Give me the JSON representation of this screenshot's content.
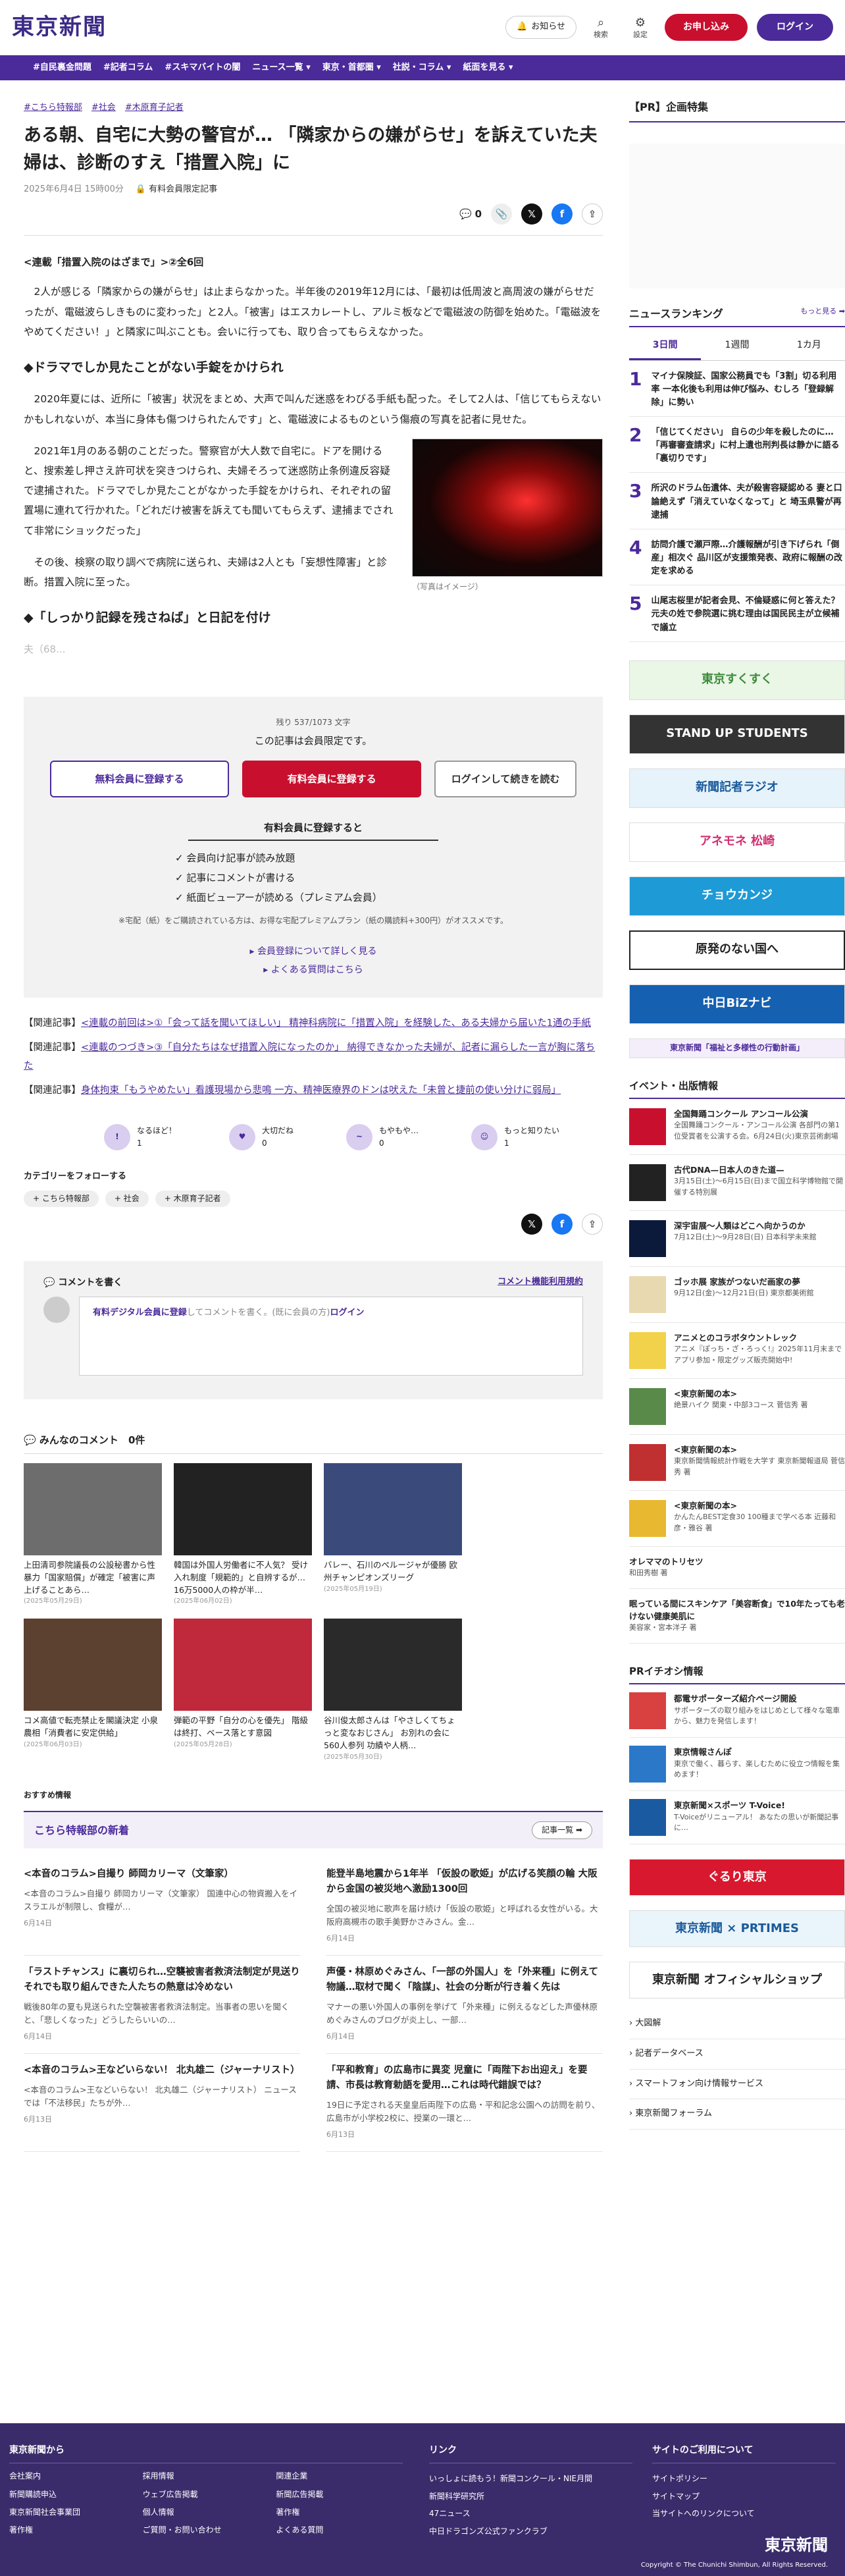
{
  "header": {
    "logo": "東京新聞",
    "notice_label": "お知らせ",
    "search_label": "検索",
    "settings_label": "設定",
    "subscribe_label": "お申し込み",
    "login_label": "ログイン"
  },
  "nav": [
    "#自民裏金問題",
    "#記者コラム",
    "#スキマバイトの闇",
    "ニュース一覧 ▾",
    "東京・首都圏 ▾",
    "社説・コラム ▾",
    "紙面を見る ▾"
  ],
  "article": {
    "tags": [
      "#こちら特報部",
      "#社会",
      "#木原育子記者"
    ],
    "title": "ある朝、自宅に大勢の警官が… 「隣家からの嫌がらせ」を訴えていた夫婦は、診断のすえ「措置入院」に",
    "date": "2025年6月4日 15時00分",
    "paid_label": "有料会員限定記事",
    "comment_count": "0",
    "series": "<連載「措置入院のはざまで」>②全6回",
    "p1": "2人が感じる「隣家からの嫌がらせ」は止まらなかった。半年後の2019年12月には、「最初は低周波と高周波の嫌がらせだったが、電磁波らしきものに変わった」と2人。「被害」はエスカレートし、アルミ板などで電磁波の防御を始めた。「電磁波をやめてください！」と隣家に叫ぶことも。会いに行っても、取り合ってもらえなかった。",
    "h1": "◆ドラマでしか見たことがない手錠をかけられ",
    "p2": "2020年夏には、近所に「被害」状況をまとめ、大声で叫んだ迷惑をわびる手紙も配った。そして2人は、「信じてもらえないかもしれないが、本当に身体も傷つけられたんです」と、電磁波によるものという傷痕の写真を記者に見せた。",
    "p3": "2021年1月のある朝のことだった。警察官が大人数で自宅に。ドアを開けると、搜索差し押さえ許可状を突きつけられ、夫婦そろって迷惑防止条例違反容疑で逮捕された。ドラマでしか見たことがなかった手錠をかけられ、それぞれの留置場に連れて行かれた。「どれだけ被害を訴えても聞いてもらえず、逮捕までされて非常にショックだった」",
    "p4": "その後、検察の取り調べで病院に送られ、夫婦は2人とも「妄想性障害」と診断。措置入院に至った。",
    "h2": "◆「しっかり記録を残さねば」と日記を付け",
    "fade": "夫（68...",
    "caption": "（写真はイメージ）"
  },
  "paywall": {
    "count": "残り 537/1073 文字",
    "message": "この記事は会員限定です。",
    "free_btn": "無料会員に登録する",
    "paid_btn": "有料会員に登録する",
    "login_btn": "ログインして続きを読む",
    "benefits_title": "有料会員に登録すると",
    "benefits": [
      "会員向け記事が読み放題",
      "記事にコメントが書ける",
      "紙面ビューアーが読める（プレミアム会員）"
    ],
    "note": "※宅配（紙）をご購読されている方は、お得な宅配プレミアムプラン（紙の購読料+300円）がオススメです。",
    "link1": "会員登録について詳しく見る",
    "link2": "よくある質問はこちら"
  },
  "related": [
    {
      "label": "【関連記事】",
      "text": "<連載の前回は>①「会って話を聞いてほしい」 精神科病院に「措置入院」を経験した、ある夫婦から届いた1通の手紙"
    },
    {
      "label": "【関連記事】",
      "text": "<連載のつづき>③「自分たちはなぜ措置入院になったのか」 納得できなかった夫婦が、記者に漏らした一言が胸に落ちた"
    },
    {
      "label": "【関連記事】",
      "text": "身体拘束「もうやめたい」看護現場から悲鳴 一方、精神医療界のドンは吠えた「未曾と捷前の使い分けに弱局」"
    }
  ],
  "reactions": [
    {
      "label": "なるほど！",
      "count": "1"
    },
    {
      "label": "大切だね",
      "count": "0"
    },
    {
      "label": "もやもや…",
      "count": "0"
    },
    {
      "label": "もっと知りたい",
      "count": "1"
    }
  ],
  "follow": {
    "title": "カテゴリーをフォローする",
    "tags": [
      "+ こちら特報部",
      "+ 社会",
      "+ 木原育子記者"
    ]
  },
  "comment": {
    "title": "コメントを書く",
    "rules": "コメント機能利用規約",
    "prompt_link": "有料デジタル会員に登録",
    "prompt_rest": "してコメントを書く。(既に会員の方)",
    "login_link": "ログイン",
    "all_title": "みんなのコメント",
    "all_count": "0件"
  },
  "photo_cards": [
    {
      "title": "上田清司参院議長の公設秘書から性暴力「国家賠償」が確定「被害に声上げることあら…",
      "date": "(2025年05月29日)",
      "color": "#6d6d6d"
    },
    {
      "title": "韓国は外国人労働者に不人気？ 受け入れ制度「規範的」と自辨するが…16万5000人の枠が半…",
      "date": "(2025年06月02日)",
      "color": "#222"
    },
    {
      "title": "バレー、石川のペルージャが優勝 欧州チャンピオンズリーグ",
      "date": "(2025年05月19日)",
      "color": "#3a4a7a"
    },
    {
      "title": "コメ高値で転売禁止を閣議決定 小泉農相「消費者に安定供給」",
      "date": "(2025年06月03日)",
      "color": "#5c4030"
    },
    {
      "title": "弾範の平野「自分の心を優先」 階級は終打、ベース落とす意図",
      "date": "(2025年05月28日)",
      "color": "#c0283c"
    },
    {
      "title": "谷川俊太郎さんは「やさしくてちょっと変なおじさん」 お別れの会に560人参列 功績や人柄…",
      "date": "(2025年05月30日)",
      "color": "#2a2a2a"
    }
  ],
  "recommend": "おすすめ情報",
  "special": {
    "title": "こちら特報部の新着",
    "more": "記事一覧 ➡",
    "items": [
      {
        "title": "<本音のコラム>自撮り 師岡カリーマ（文筆家）",
        "excerpt": "<本音のコラム>自撮り 師岡カリーマ（文筆家） 国連中心の物資搬入をイスラエルが制限し、食糧が…",
        "date": "6月14日"
      },
      {
        "title": "能登半島地震から1年半 「仮設の歌姫」が広げる笑顔の輪 大阪から金国の被災地へ激励1300回",
        "excerpt": "全国の被災地に歌声を届け続け「仮設の歌姫」と呼ばれる女性がいる。大阪府高槻市の歌手美野かさみさん。金…",
        "date": "6月14日"
      },
      {
        "title": "「ラストチャンス」に裏切られ…空襲被害者救済法制定が見送り それでも取り組んできた人たちの熱意は冷めない",
        "excerpt": "戦後80年の夏も見送られた空襲被害者救済法制定。当事者の思いを聞くと、「悲しくなった」どうしたらいいの…",
        "date": "6月14日"
      },
      {
        "title": "声優・林原めぐみさん、「一部の外国人」を「外来種」に例えて物議…取材で聞く「陰謀」、社会の分断が行き着く先は",
        "excerpt": "マナーの悪い外国人の事例を挙げて「外来種」に例えるなどした声優林原めぐみさんのブログが炎上し、一部…",
        "date": "6月14日"
      },
      {
        "title": "<本音のコラム>王などいらない！ 北丸雄二（ジャーナリスト）",
        "excerpt": "<本音のコラム>王などいらない！ 北丸雄二（ジャーナリスト） ニュースでは「不法移民」たちが外…",
        "date": "6月13日"
      },
      {
        "title": "「平和教育」の広島市に異変 児童に「両陛下お出迎え」を要請、市長は教育勅語を愛用…これは時代錯誤では？",
        "excerpt": "19日に予定される天皇皇后両陛下の広島・平和記念公園への訪問を前り、広島市が小学校2校に、授業の一環と…",
        "date": "6月13日"
      }
    ]
  },
  "side": {
    "pr_title": "【PR】企画特集",
    "rank_title": "ニュースランキング",
    "rank_more": "もっと見る ➡",
    "rank_tabs": [
      "3日間",
      "1週間",
      "1カ月"
    ],
    "rank_items": [
      "マイナ保険証、国家公務員でも「3割」切る利用率 一本化後も利用は伸び悩み、むしろ「登録解除」に勢い",
      "「信じてください」 自らの少年を殺したのに…「再審審査請求」に村上遺也刑判長は静かに語る「裏切りです」",
      "所沢のドラム缶遺体、夫が殺害容疑認める 妻と口論絶えず「消えていなくなって」と 埼玉県警が再逮捕",
      "訪問介護で瀬戸際…介護報酬が引き下げられ「倒産」相次ぐ 品川区が支援策発表、政府に報酬の改定を求める",
      "山尾志桜里が記者会見、不倫疑惑に何と答えた？ 元夫の姓で参院選に挑む理由は国民民主が立候補で議立"
    ],
    "banners": [
      "東京すくすく",
      "STAND UP STUDENTS",
      "新聞記者ラジオ",
      "アネモネ 松崎",
      "チョウカンジ",
      "原発のない国へ",
      "中日BiZナビ",
      "東京新聞「福祉と多様性の行動計画」"
    ],
    "events_title": "イベント・出版情報",
    "events": [
      {
        "title": "全国舞踊コンクール アンコール公演",
        "text": "全国舞踊コンクール・アンコール公演 各部門の第1位受賞者を公演する会。6月24日(火)東京芸術劇場"
      },
      {
        "title": "古代DNA—日本人のきた道—",
        "text": "3月15日(土)～6月15日(日)まで国立科学博物館で開催する特別展"
      },
      {
        "title": "深宇宙展〜人類はどこへ向かうのか",
        "text": "7月12日(土)～9月28日(日) 日本科学未来館"
      },
      {
        "title": "ゴッホ展 家族がつないだ画家の夢",
        "text": "9月12日(金)～12月21日(日) 東京都美術館"
      },
      {
        "title": "アニメとのコラボタウントレック",
        "text": "アニメ『ぽっち・ざ・ろっく!』2025年11月末までアプリ参加・限定グッズ販売開始中!"
      },
      {
        "title": "<東京新聞の本>",
        "text": "絶景ハイク 関東・中部3コース 菅信秀 著"
      },
      {
        "title": "<東京新聞の本>",
        "text": "東京新聞情報統計作戦を大学す 東京新聞報道局 菅信秀 著"
      },
      {
        "title": "<東京新聞の本>",
        "text": "かんたんBEST定食30 100種まで学べる本 近藤和彦・雅谷 著"
      },
      {
        "title": "オレママのトリセツ",
        "text": "和田秀樹 著"
      },
      {
        "title": "眠っている間にスキンケア「美容断食」で10年たっても老けない健康美肌に",
        "text": "美容家・宮本洋子 著"
      }
    ],
    "pr_info_title": "PRイチオシ情報",
    "pr_info": [
      {
        "title": "都電サポーターズ紹介ページ開設",
        "text": "サポーターズの取り組みをはじめとして様々な電車から、魅力を発信します！"
      },
      {
        "title": "東京情報さんぽ",
        "text": "東京で働く、暮らす、楽しむために役立つ情報を集めます！"
      },
      {
        "title": "東京新聞×スポーツ T-Voice!",
        "text": "T-Voiceがリニューアル！ あなたの思いが新聞記事に…"
      }
    ],
    "banners2": [
      "ぐるり東京",
      "東京新聞 × PRTIMES",
      "東京新聞 オフィシャルショップ"
    ],
    "links": [
      "大図解",
      "記者データベース",
      "スマートフォン向け情報サービス",
      "東京新聞フォーラム"
    ]
  },
  "footer": {
    "col1_title": "東京新聞から",
    "col1": [
      "会社案内",
      "採用情報",
      "関連企業",
      "新聞購読申込",
      "ウェブ広告掲載",
      "新聞広告掲載",
      "東京新聞社会事業団",
      "著作権",
      "個人情報",
      "著作権",
      "ご質問・お問い合わせ",
      "よくある質問"
    ],
    "col2_title": "リンク",
    "col2": [
      "いっしょに読もう！新聞コンクール・NIE月間",
      "新聞科学研究所",
      "47ニュース",
      "中日ドラゴンズ公式ファンクラブ"
    ],
    "col3_title": "サイトのご利用について",
    "col3": [
      "サイトポリシー",
      "サイトマップ",
      "当サイトへのリンクについて"
    ],
    "logo": "東京新聞",
    "copy": "Copyright © The Chunichi Shimbun, All Rights Reserved."
  }
}
